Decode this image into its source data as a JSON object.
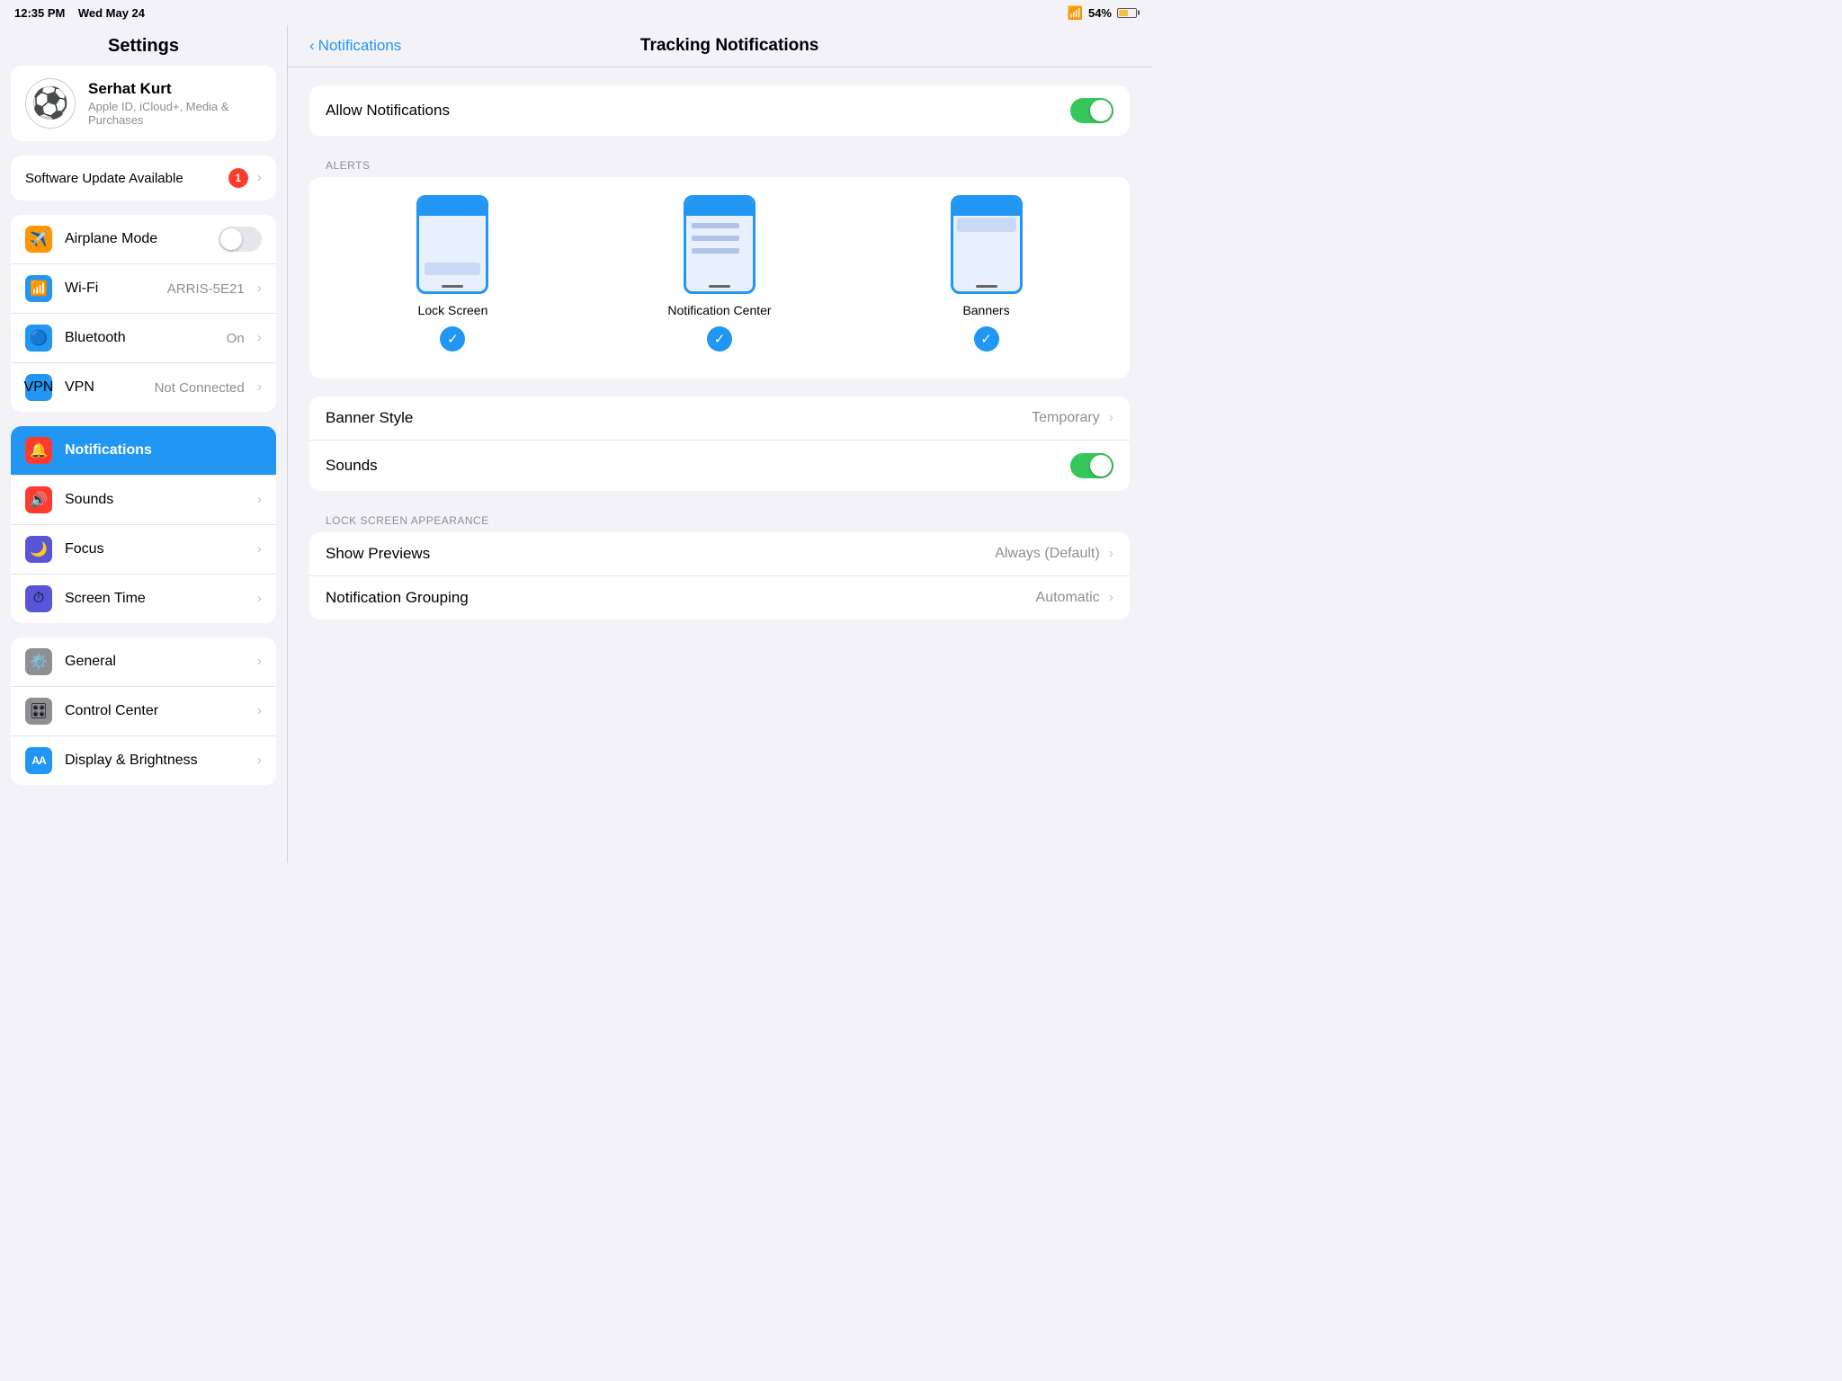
{
  "statusBar": {
    "time": "12:35 PM",
    "date": "Wed May 24",
    "wifi": "📶",
    "battery": "54%"
  },
  "sidebar": {
    "title": "Settings",
    "profile": {
      "name": "Serhat Kurt",
      "subtitle": "Apple ID, iCloud+, Media & Purchases",
      "avatar": "⚽"
    },
    "updateLabel": "Software Update Available",
    "updateCount": "1",
    "settingsGroups": [
      {
        "id": "group1",
        "items": [
          {
            "id": "airplane",
            "label": "Airplane Mode",
            "iconBg": "#ff9500",
            "icon": "✈️",
            "control": "toggle-off"
          },
          {
            "id": "wifi",
            "label": "Wi-Fi",
            "iconBg": "#2196f3",
            "icon": "📶",
            "value": "ARRIS-5E21",
            "control": "value"
          },
          {
            "id": "bluetooth",
            "label": "Bluetooth",
            "iconBg": "#2196f3",
            "icon": "🔵",
            "value": "On",
            "control": "value"
          },
          {
            "id": "vpn",
            "label": "VPN",
            "iconBg": "#2196f3",
            "icon": "🔒",
            "value": "Not Connected",
            "control": "value"
          }
        ]
      },
      {
        "id": "group2",
        "items": [
          {
            "id": "notifications",
            "label": "Notifications",
            "iconBg": "#ff3b30",
            "icon": "🔔",
            "active": true,
            "control": "none"
          },
          {
            "id": "sounds",
            "label": "Sounds",
            "iconBg": "#ff3b30",
            "icon": "🔊",
            "control": "none"
          },
          {
            "id": "focus",
            "label": "Focus",
            "iconBg": "#5856d6",
            "icon": "🌙",
            "control": "none"
          },
          {
            "id": "screentime",
            "label": "Screen Time",
            "iconBg": "#5856d6",
            "icon": "⏱",
            "control": "none"
          }
        ]
      },
      {
        "id": "group3",
        "items": [
          {
            "id": "general",
            "label": "General",
            "iconBg": "#8e8e93",
            "icon": "⚙️",
            "control": "none"
          },
          {
            "id": "controlcenter",
            "label": "Control Center",
            "iconBg": "#8e8e93",
            "icon": "🎛",
            "control": "none"
          },
          {
            "id": "displaybrightness",
            "label": "Display & Brightness",
            "iconBg": "#2196f3",
            "icon": "AA",
            "control": "none"
          }
        ]
      }
    ]
  },
  "detail": {
    "backLabel": "Notifications",
    "title": "Tracking Notifications",
    "allowNotifications": {
      "label": "Allow Notifications",
      "enabled": true
    },
    "alertsSection": {
      "header": "ALERTS",
      "options": [
        {
          "id": "lock-screen",
          "label": "Lock Screen",
          "checked": true
        },
        {
          "id": "notification-center",
          "label": "Notification Center",
          "checked": true
        },
        {
          "id": "banners",
          "label": "Banners",
          "checked": true
        }
      ]
    },
    "bannerStyle": {
      "label": "Banner Style",
      "value": "Temporary"
    },
    "sounds": {
      "label": "Sounds",
      "enabled": true
    },
    "lockScreenSection": {
      "header": "LOCK SCREEN APPEARANCE",
      "showPreviews": {
        "label": "Show Previews",
        "value": "Always (Default)"
      },
      "notificationGrouping": {
        "label": "Notification Grouping",
        "value": "Automatic"
      }
    }
  }
}
